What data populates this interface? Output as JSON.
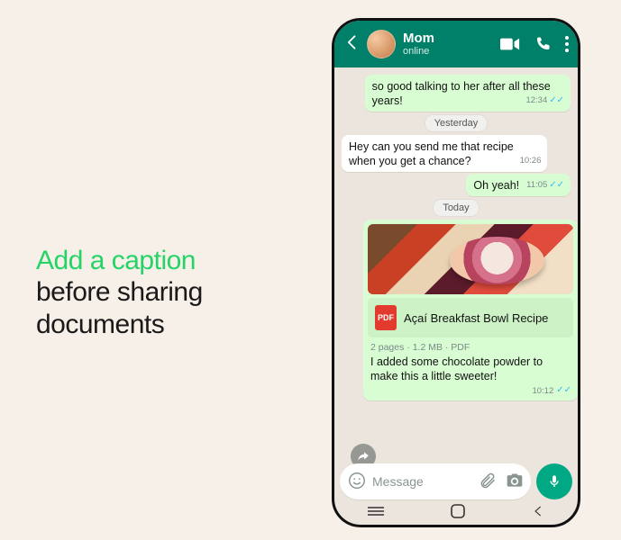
{
  "promo": {
    "line1": "Add a caption",
    "line2": "before sharing",
    "line3": "documents"
  },
  "header": {
    "contact_name": "Mom",
    "status": "online"
  },
  "separators": {
    "yesterday": "Yesterday",
    "today": "Today"
  },
  "messages": {
    "m1": {
      "text": "so good talking to her after all these years!",
      "time": "12:34"
    },
    "m2": {
      "text": "Hey can you send me that recipe when you get a chance?",
      "time": "10:26"
    },
    "m3": {
      "text": "Oh yeah!",
      "time": "11:05"
    }
  },
  "document": {
    "title": "Açaí Breakfast Bowl Recipe",
    "info": "2 pages · 1.2 MB · PDF",
    "pdf_badge": "PDF",
    "caption": "I added some chocolate powder to make this a little sweeter!",
    "time": "10:12"
  },
  "composer": {
    "placeholder": "Message"
  }
}
